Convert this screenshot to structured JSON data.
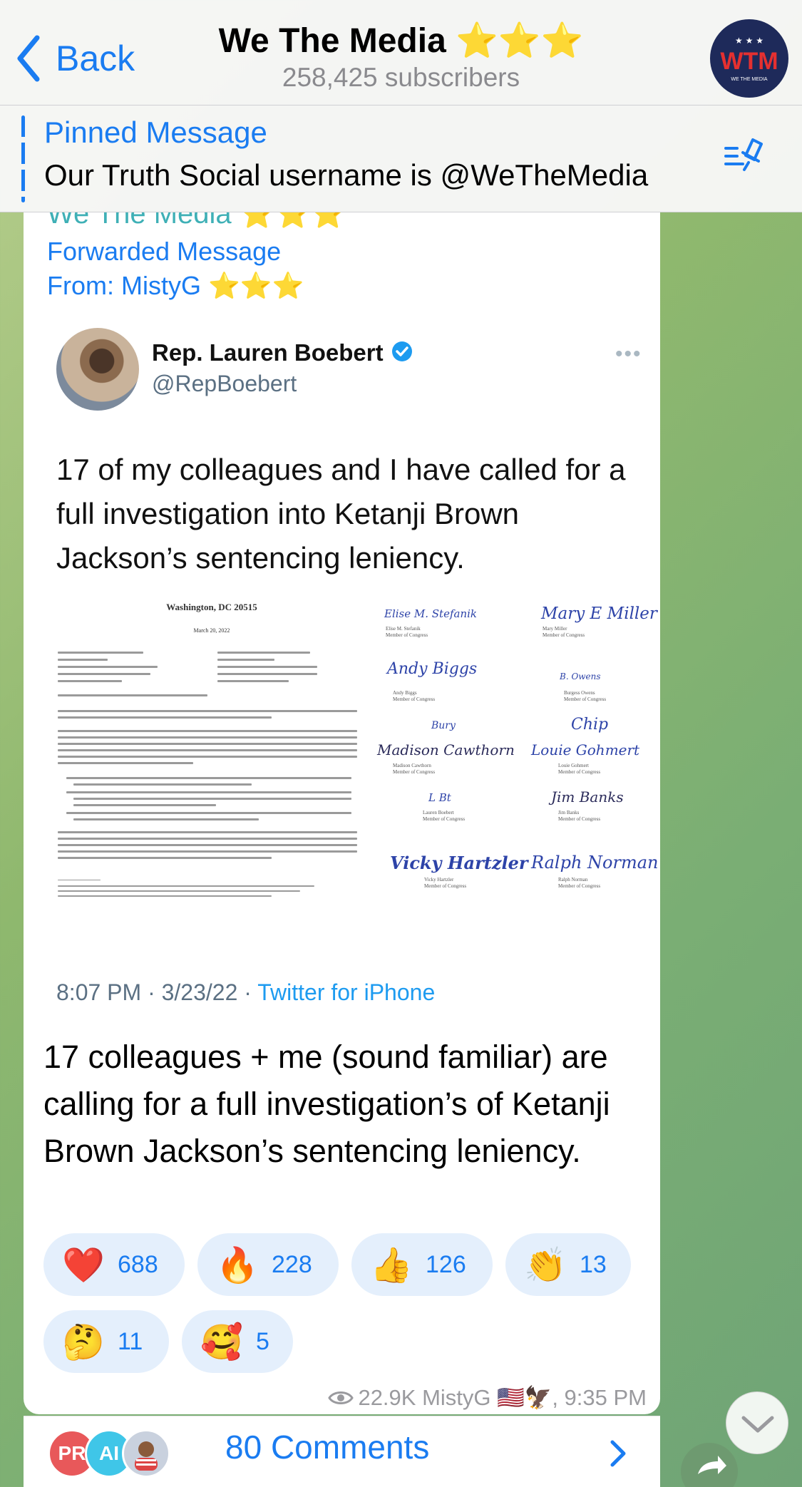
{
  "header": {
    "back_label": "Back",
    "title": "We The Media ⭐⭐⭐",
    "subtitle": "258,425 subscribers",
    "avatar_text": "WTM",
    "avatar_sub": "WE THE MEDIA"
  },
  "pinned": {
    "title": "Pinned Message",
    "text": "Our Truth Social username is @WeTheMedia"
  },
  "post": {
    "channel_name": "We The Media ⭐⭐⭐",
    "forwarded_label": "Forwarded Message",
    "from_label": "From: MistyG ⭐⭐⭐",
    "tweet": {
      "name": "Rep. Lauren Boebert",
      "handle": "@RepBoebert",
      "text": "17 of my colleagues and I have called for a full investigation into Ketanji Brown Jackson’s sentencing leniency.",
      "timestamp": "8:07 PM · 3/23/22 · ",
      "source": "Twitter for iPhone",
      "letter": {
        "letterhead": "Washington, DC 20515",
        "date": "March 20, 2022",
        "signatures": [
          {
            "sig": "Elise M. Stefanik",
            "name": "Elise M. Stefanik",
            "title": "Member of Congress"
          },
          {
            "sig": "Mary E Miller",
            "name": "Mary Miller",
            "title": "Member of Congress"
          },
          {
            "sig": "Andy Biggs",
            "name": "Andy Biggs",
            "title": "Member of Congress"
          },
          {
            "sig": "B. Owens",
            "name": "Burgess Owens",
            "title": "Member of Congress"
          },
          {
            "sig": "Bury",
            "name": "",
            "title": ""
          },
          {
            "sig": "Chip",
            "name": "",
            "title": ""
          },
          {
            "sig": "Madison Cawthorn",
            "name": "Madison Cawthorn",
            "title": "Member of Congress"
          },
          {
            "sig": "Louie Gohmert",
            "name": "Louie Gohmert",
            "title": "Member of Congress"
          },
          {
            "sig": "L Bt",
            "name": "Lauren Boebert",
            "title": "Member of Congress"
          },
          {
            "sig": "Jim Banks",
            "name": "Jim Banks",
            "title": "Member of Congress"
          },
          {
            "sig": "Vicky Hartzler",
            "name": "Vicky Hartzler",
            "title": "Member of Congress"
          },
          {
            "sig": "Ralph Norman",
            "name": "Ralph Norman",
            "title": "Member of Congress"
          }
        ]
      }
    },
    "message": "17 colleagues + me (sound familiar) are calling for a full investigation’s of Ketanji Brown Jackson’s sentencing leniency.",
    "reactions": [
      {
        "emoji": "❤️",
        "count": "688"
      },
      {
        "emoji": "🔥",
        "count": "228"
      },
      {
        "emoji": "👍",
        "count": "126"
      },
      {
        "emoji": "👏",
        "count": "13"
      },
      {
        "emoji": "🤔",
        "count": "11"
      },
      {
        "emoji": "🥰",
        "count": "5"
      }
    ],
    "meta": "22.9K MistyG 🇺🇸🦅, 9:35 PM"
  },
  "comments": {
    "label": "80 Comments",
    "avatars": [
      {
        "text": "PR",
        "color": "#e8585a"
      },
      {
        "text": "AI",
        "color": "#3fc6e8"
      },
      {
        "text": "",
        "color": "#c9d1de"
      }
    ]
  },
  "colors": {
    "accent": "#1a7cf1",
    "reaction_bg": "#e4effc",
    "channel_name": "#3fb0b6",
    "tweet_link": "#1d9bf0"
  },
  "icons": [
    "chevron-left-icon",
    "pin-list-icon",
    "verified-badge-icon",
    "eye-icon",
    "chevron-right-icon",
    "chevron-down-icon",
    "share-icon"
  ]
}
